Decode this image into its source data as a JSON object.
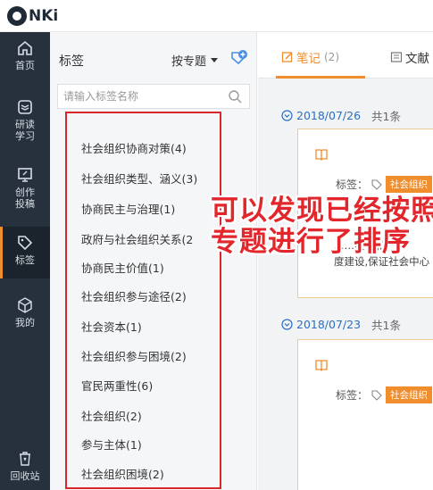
{
  "app": {
    "logo_text": "NKi"
  },
  "nav": {
    "items": [
      {
        "label_lines": [
          "首页"
        ],
        "icon": "home-icon"
      },
      {
        "label_lines": [
          "研读",
          "学习"
        ],
        "icon": "layers-icon"
      },
      {
        "label_lines": [
          "创作",
          "投稿"
        ],
        "icon": "monitor-icon"
      },
      {
        "label_lines": [
          "标签"
        ],
        "icon": "tag-icon",
        "active": true
      },
      {
        "label_lines": [
          "我的"
        ],
        "icon": "cube-icon"
      },
      {
        "label_lines": [
          "回收站"
        ],
        "icon": "trash-icon"
      }
    ],
    "label_0": "首页",
    "label_1a": "研读",
    "label_1b": "学习",
    "label_2a": "创作",
    "label_2b": "投稿",
    "label_3": "标签",
    "label_4": "我的",
    "label_5": "回收站"
  },
  "tag_panel": {
    "title": "标签",
    "sort_label": "按专题",
    "search_placeholder": "请输入标签名称",
    "tags": [
      "社会组织协商对策(4)",
      "社会组织类型、涵义(3)",
      "协商民主与治理(1)",
      "政府与社会组织关系(2",
      "协商民主价值(1)",
      "社会组织参与途径(2)",
      "社会资本(1)",
      "社会组织参与困境(2)",
      "官民两重性(6)",
      "社会组织(2)",
      "参与主体(1)",
      "社会组织困境(2)"
    ]
  },
  "tabs": {
    "notes_label": "笔记",
    "notes_count": "(2)",
    "docs_label": "文献"
  },
  "notes": {
    "group1": {
      "date": "2018/07/26",
      "count": "共1条"
    },
    "group2": {
      "date": "2018/07/23",
      "count": "共1条"
    },
    "card1": {
      "tag_prefix": "标签：",
      "chip": "社会组织",
      "line1": "……实性和",
      "line2": "度建设,保证社会中心"
    },
    "card2": {
      "tag_prefix": "标签：",
      "chip": "社会组织"
    }
  },
  "annotation": {
    "line1": "可以发现已经按照",
    "line2": "专题进行了排序"
  },
  "colors": {
    "accent": "#f08d2c",
    "nav_bg": "#26313d",
    "highlight_red": "#d9262a",
    "link_blue": "#2a6fc4"
  }
}
